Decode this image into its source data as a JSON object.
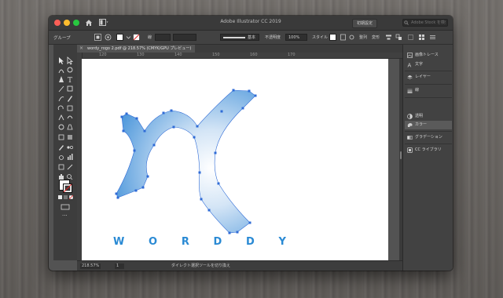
{
  "app": {
    "title": "Adobe Illustrator CC 2019",
    "workspace_button": "初期設定",
    "search_placeholder": "Adobe Stock を検索"
  },
  "control_bar": {
    "selection_label": "グループ",
    "stroke_profile_label": "基本",
    "opacity_label": "不透明度",
    "opacity_value": "100%",
    "style_label": "スタイル",
    "align_label": "整列",
    "transform_label": "変形"
  },
  "document": {
    "tab_title": "wordy_rogo 2.pdf @ 218.57% (CMYK/GPU プレビュー)",
    "ruler_ticks": [
      "120",
      "130",
      "140",
      "150",
      "160",
      "170"
    ],
    "logo_text": [
      "W",
      "O",
      "R",
      "D",
      "D",
      "Y"
    ]
  },
  "status_bar": {
    "zoom": "218.57%",
    "page": "1",
    "tool_hint": "ダイレクト選択ツールを切り換え"
  },
  "panels": [
    {
      "icon": "image-trace-icon",
      "label": "画像トレース"
    },
    {
      "icon": "type-icon",
      "label": "文字"
    },
    {
      "icon": "layers-icon",
      "label": "レイヤー"
    },
    {
      "icon": "brush-icon",
      "label": "線"
    },
    {
      "icon": "transparency-icon",
      "label": "透明"
    },
    {
      "icon": "color-icon",
      "label": "カラー"
    },
    {
      "icon": "gradient-icon",
      "label": "グラデーション"
    },
    {
      "icon": "cc-libraries-icon",
      "label": "CC ライブラリ"
    }
  ],
  "colors": {
    "logo_blue": "#2a8ad4",
    "gradient_light": "#e6f0fa",
    "gradient_dark": "#3f8fd8",
    "selection_blue": "#2f6bd6"
  }
}
